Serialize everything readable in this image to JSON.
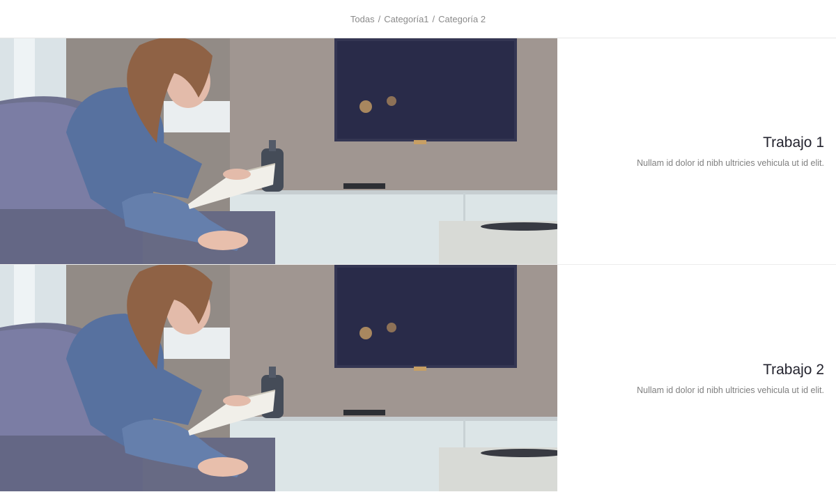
{
  "filters": {
    "all": "Todas",
    "separator": "/",
    "category1": "Categoría1",
    "category2": "Categoría 2"
  },
  "works": [
    {
      "title": "Trabajo 1",
      "description": "Nullam id dolor id nibh ultricies vehicula ut id elit."
    },
    {
      "title": "Trabajo 2",
      "description": "Nullam id dolor id nibh ultricies vehicula ut id elit."
    }
  ]
}
